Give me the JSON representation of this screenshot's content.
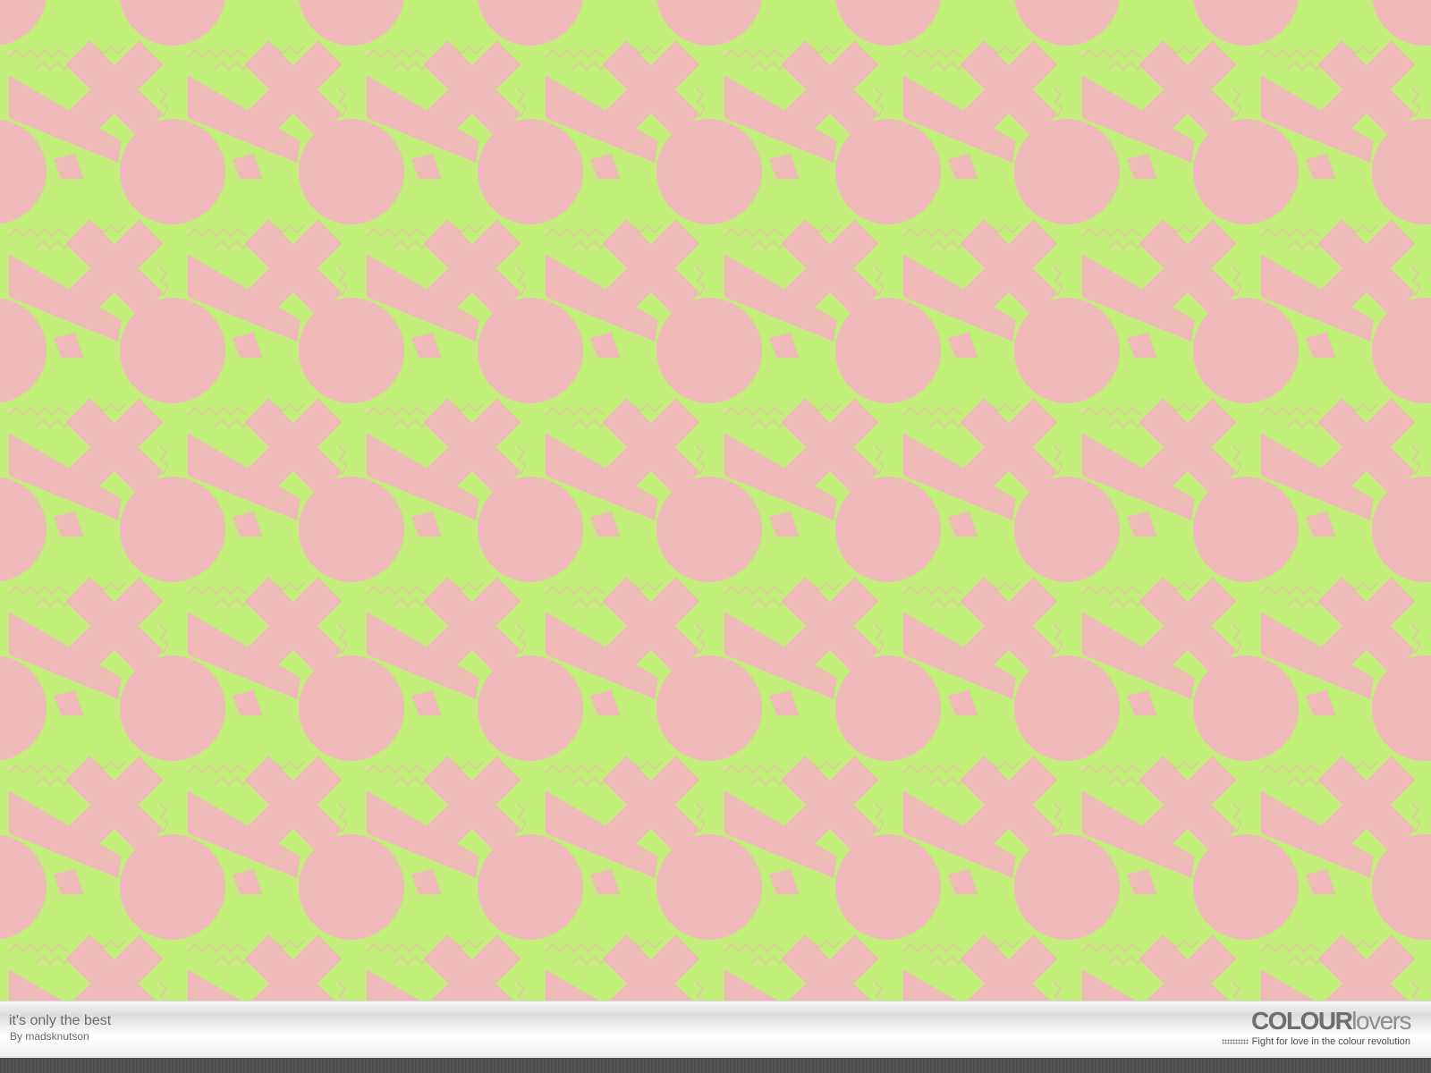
{
  "pattern": {
    "background_color": "#c2ee7a",
    "shape_color": "#f0babb",
    "zigzag_color": "#e2c5a2",
    "motif_shapes": [
      "circle",
      "cross",
      "arrow",
      "zigzag"
    ]
  },
  "footer": {
    "title": "it's only the best",
    "author": "By madsknutson",
    "logo_bold": "COLOUR",
    "logo_light": "lovers",
    "tagline": "Fight for love in the colour revolution"
  }
}
